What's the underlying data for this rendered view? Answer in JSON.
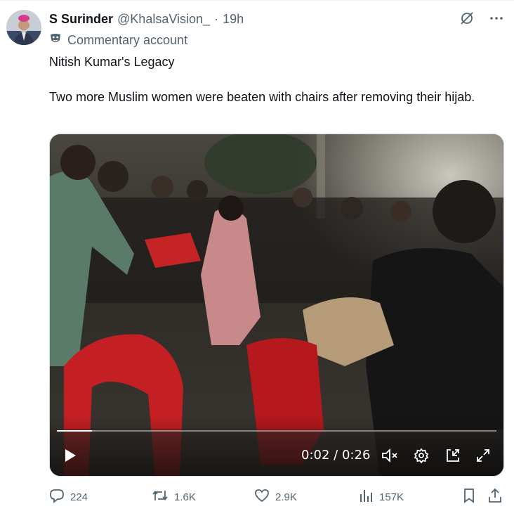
{
  "author": {
    "display_name": "S Surinder",
    "handle": "@KhalsaVision_",
    "separator": "·",
    "time": "19h",
    "label": "Commentary account"
  },
  "tweet": {
    "line1": "Nitish Kumar's Legacy",
    "line2": "Two more Muslim women were beaten with chairs after removing their hijab."
  },
  "video": {
    "current_time": "0:02",
    "duration": "0:26",
    "time_separator": "/",
    "progress": 0.08
  },
  "actions": {
    "replies": "224",
    "reposts": "1.6K",
    "likes": "2.9K",
    "views": "157K"
  },
  "icons": [
    "grok-icon",
    "more-icon",
    "commentary-mask-icon",
    "play-icon",
    "mute-icon",
    "settings-icon",
    "dock-icon",
    "fullscreen-icon",
    "reply-icon",
    "repost-icon",
    "like-icon",
    "views-icon",
    "bookmark-icon",
    "share-icon"
  ]
}
